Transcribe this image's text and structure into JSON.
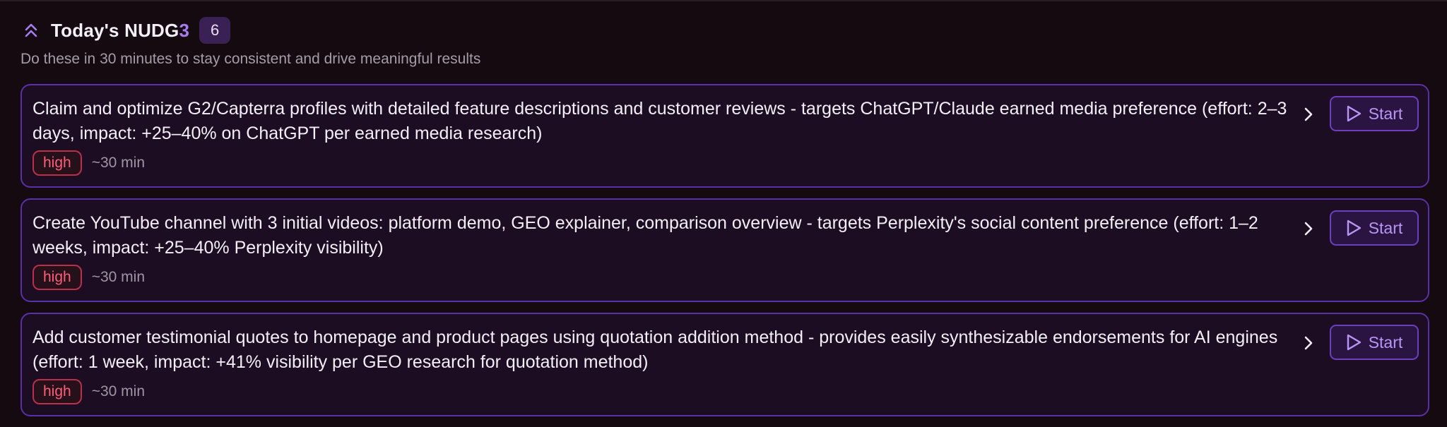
{
  "header": {
    "title_prefix": "Today's NUDG",
    "title_accent": "3",
    "count": "6",
    "subtitle": "Do these in 30 minutes to stay consistent and drive meaningful results",
    "collapse_icon": "chevrons-up-icon"
  },
  "colors": {
    "background": "#150a10",
    "card_border": "#5b2fa8",
    "accent": "#a77cf0",
    "priority_high": "#ff5d79"
  },
  "nudges": [
    {
      "text": "Claim and optimize G2/Capterra profiles with detailed feature descriptions and customer reviews - targets ChatGPT/Claude earned media preference (effort: 2–3 days, impact: +25–40% on ChatGPT per earned media research)",
      "priority": "high",
      "duration": "~30 min",
      "action_label": "Start"
    },
    {
      "text": "Create YouTube channel with 3 initial videos: platform demo, GEO explainer, comparison overview - targets Perplexity's social content preference (effort: 1–2 weeks, impact: +25–40% Perplexity visibility)",
      "priority": "high",
      "duration": "~30 min",
      "action_label": "Start"
    },
    {
      "text": "Add customer testimonial quotes to homepage and product pages using quotation addition method - provides easily synthesizable endorsements for AI engines (effort: 1 week, impact: +41% visibility per GEO research for quotation method)",
      "priority": "high",
      "duration": "~30 min",
      "action_label": "Start"
    }
  ]
}
